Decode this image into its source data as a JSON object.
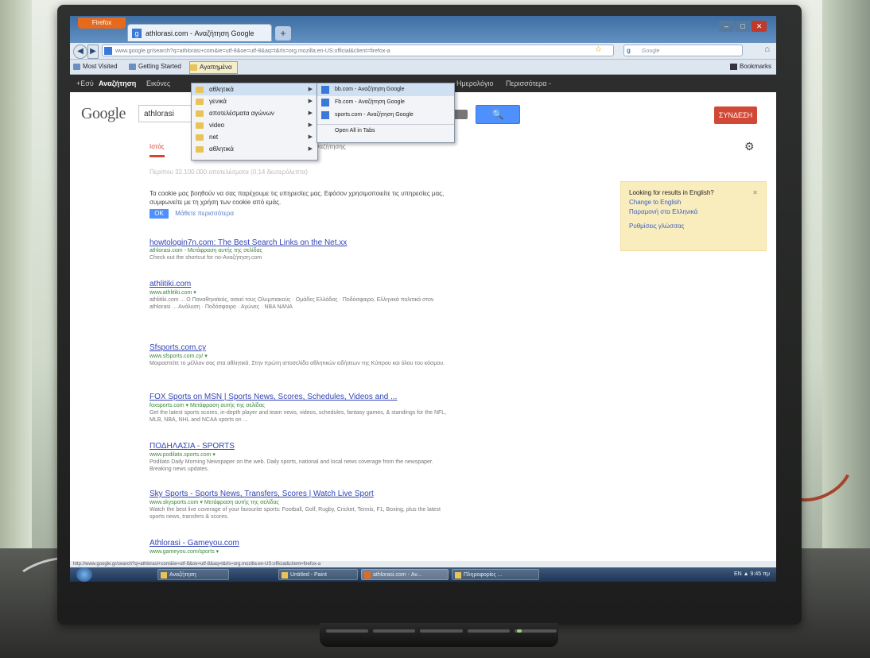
{
  "browser": {
    "firefox_button": "Firefox",
    "tab_title": "athlorasi.com - Αναζήτηση Google",
    "new_tab": "+",
    "url": "www.google.gr/search?q=athlorasi+com&ie=utf-8&oe=utf-8&aq=t&rls=org.mozilla:en-US:official&client=firefox-a",
    "search_placeholder": "Google",
    "window_controls": [
      "–",
      "□",
      "✕"
    ]
  },
  "bookmarks": {
    "items": [
      "Most Visited",
      "Getting Started",
      "Αγαπημένα"
    ],
    "right": "Bookmarks"
  },
  "google_bar": {
    "items": [
      "+Εσύ",
      "Αναζήτηση",
      "Εικόνες",
      "Χάρτες",
      "Play",
      "YouTube",
      "Ειδήσεις",
      "Gmail",
      "Έγγραφα",
      "Ημερολόγιο",
      "Περισσότερα -"
    ]
  },
  "menu": {
    "folders": [
      "αθλητικά",
      "γενικά",
      "αποτελέσματα αγώνων",
      "video",
      "net",
      "αθλητικά"
    ],
    "submenu": [
      "bb.com - Αναζήτηση Google",
      "Fb.com - Αναζήτηση Google",
      "sports.com - Αναζήτηση Google"
    ],
    "open_all": "Open All in Tabs"
  },
  "google": {
    "logo": "Google",
    "query": "athlorasi",
    "search_icon": "🔍",
    "signin": "ΣΥΝΔΕΣΗ",
    "tab_web": "Ιστός",
    "tab_more": "Εργαλεία αναζήτησης",
    "stats": "Περίπου 32.100.000 αποτελέσματα (0,14 δευτερόλεπτα)",
    "cookie_text": "Τα cookie μας βοηθούν να σας παρέχουμε τις υπηρεσίες μας. Εφόσον χρησιμοποιείτε τις υπηρεσίες μας, συμφωνείτε με τη χρήση των cookie από εμάς.",
    "cookie_ok": "OK",
    "cookie_link": "Μάθετε περισσότερα"
  },
  "results": [
    {
      "title": "howtologin7n.com: The Best Search Links on the Net.xx",
      "url": "athlorasi.com - Μετάφραση αυτής της σελίδας",
      "snippet": "Check out the shortcut for no-Αναζήτηση.com"
    },
    {
      "title": "athlitiki.com",
      "url": "www.athlitiki.com ▾",
      "snippet": "athlitiki.com ... Ο Παναθηναϊκός, ασκεί τους Ολυμπιακούς · Ομάδες Ελλάδας · Ποδόσφαιρο, Ελληνικά πολιτικά στον athlorasi ... Ανάλυση · Ποδόσφαιρο · Αγώνες · ΝΒΑ ΝΑΝΑ"
    },
    {
      "title": "Sfsports.com.cy",
      "url": "www.sfsports.com.cy/ ▾",
      "snippet": "Μοιραστείτε το μέλλον σας στα αθλητικά. Στην πρώτη ιστοσελίδα αθλητικών ειδήσεων της Κύπρου και όλου του κόσμου."
    },
    {
      "title": "FOX Sports on MSN | Sports News, Scores, Schedules, Videos and ...",
      "url": "foxsports.com ▾ Μετάφραση αυτής της σελίδας",
      "snippet": "Get the latest sports scores, in-depth player and team news, videos, schedules, fantasy games, & standings for the NFL, MLB, NBA, NHL and NCAA sports on ..."
    },
    {
      "title": "ΠΟΔΗΛΑΣΙΑ - SPORTS",
      "url": "www.podilato.sports.com ▾",
      "snippet": "Podilato Daily Morning Newspaper on the web. Daily sports, national and local news coverage from the newspaper. Breaking news updates."
    },
    {
      "title": "Sky Sports - Sports News, Transfers, Scores | Watch Live Sport",
      "url": "www.skysports.com ▾ Μετάφραση αυτής της σελίδας",
      "snippet": "Watch the best live coverage of your favourite sports: Football, Golf, Rugby, Cricket, Tennis, F1, Boxing, plus the latest sports news, transfers & scores."
    },
    {
      "title": "Athlorasi - Gameyou.com",
      "url": "www.gameyou.com/sports ▾",
      "snippet": ""
    }
  ],
  "english_box": {
    "title": "Looking for results in English?",
    "link1": "Change to English",
    "link2": "Παραμονή στα Ελληνικά",
    "link3": "Ρυθμίσεις γλώσσας",
    "close": "✕"
  },
  "status_url": "http://www.google.gr/search?q=athlorasi+com&ie=utf-8&oe=utf-8&aq=t&rls=org.mozilla:en-US:official&client=firefox-a",
  "taskbar": {
    "items": [
      "Αναζήτηση",
      "Untitled - Paint",
      "athlorasi.com - Αν...",
      "Πληροφορίες ..."
    ],
    "clock": "EN  ▲  9:45 πμ"
  }
}
